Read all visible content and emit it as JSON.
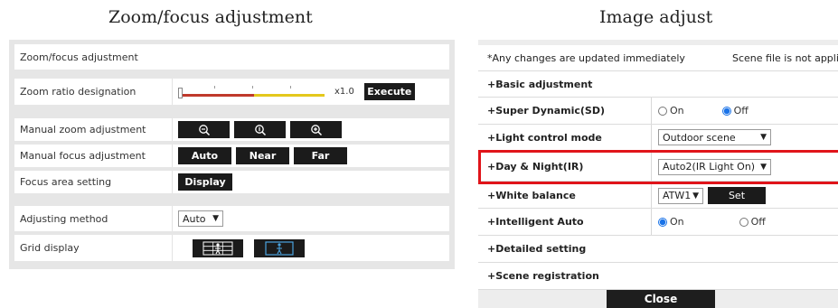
{
  "captions": {
    "left": "Zoom/focus adjustment",
    "right": "Image adjust"
  },
  "zoom_focus": {
    "header": "Zoom/focus adjustment",
    "zoom_ratio": {
      "label": "Zoom ratio designation",
      "value": "x1.0",
      "execute": "Execute",
      "slider_position": 0.0
    },
    "manual_zoom": {
      "label": "Manual zoom adjustment",
      "buttons": [
        "zoom-out",
        "zoom-reset",
        "zoom-in"
      ]
    },
    "manual_focus": {
      "label": "Manual focus adjustment",
      "buttons": [
        "Auto",
        "Near",
        "Far"
      ]
    },
    "focus_area": {
      "label": "Focus area setting",
      "button": "Display"
    },
    "adjusting_method": {
      "label": "Adjusting method",
      "value": "Auto"
    },
    "grid_display": {
      "label": "Grid display",
      "options": [
        "grid-person-icon",
        "person-icon"
      ]
    }
  },
  "image_adjust": {
    "notice": "*Any changes are updated immediately",
    "notice_right": "Scene file is not applied",
    "rows": {
      "basic": "+Basic adjustment",
      "super_dynamic": {
        "label": "+Super Dynamic(SD)",
        "on": "On",
        "off": "Off",
        "selected": "Off"
      },
      "light_control": {
        "label": "+Light control mode",
        "value": "Outdoor scene"
      },
      "day_night": {
        "label": "+Day & Night(IR)",
        "value": "Auto2(IR Light On)"
      },
      "white_balance": {
        "label": "+White balance",
        "value": "ATW1",
        "set": "Set"
      },
      "intelligent_auto": {
        "label": "+Intelligent Auto",
        "on": "On",
        "off": "Off",
        "selected": "On"
      },
      "detailed": "+Detailed setting",
      "scene_registration": "+Scene registration"
    },
    "close": "Close"
  },
  "colors": {
    "highlight": "#e0141a",
    "radio_selected": "#1a73e8",
    "button": "#1b1b1b",
    "zoom_bar_red": "#c0392b",
    "zoom_bar_yellow": "#e4c81c"
  }
}
